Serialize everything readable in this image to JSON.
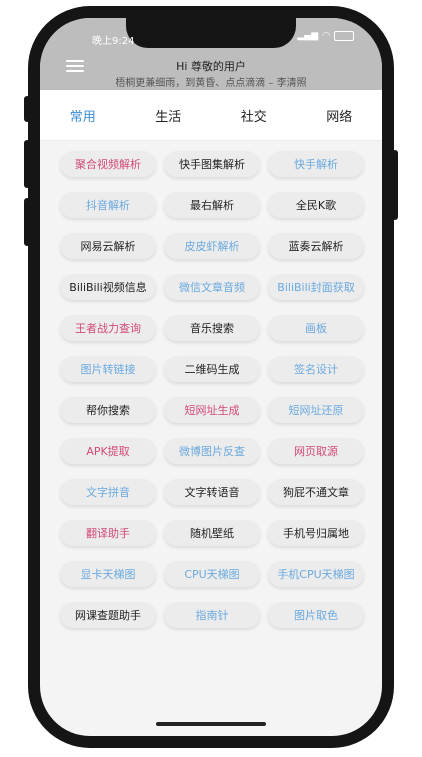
{
  "status": {
    "time": "晚上9:24"
  },
  "header": {
    "greeting": "Hi 尊敬的用户",
    "subtitle": "梧桐更兼细雨，到黄昏、点点滴滴 – 李清照"
  },
  "tabs": [
    {
      "label": "常用",
      "active": true
    },
    {
      "label": "生活",
      "active": false
    },
    {
      "label": "社交",
      "active": false
    },
    {
      "label": "网络",
      "active": false
    }
  ],
  "colors": {
    "pink": "#d24a77",
    "blue": "#6aa9df",
    "dark": "#222222",
    "active_tab": "#3b8ed6",
    "header_bg": "#bdbdbd"
  },
  "tools": [
    {
      "label": "聚合视频解析",
      "color": "pink"
    },
    {
      "label": "快手图集解析",
      "color": "dark"
    },
    {
      "label": "快手解析",
      "color": "blue"
    },
    {
      "label": "抖音解析",
      "color": "blue"
    },
    {
      "label": "最右解析",
      "color": "dark"
    },
    {
      "label": "全民K歌",
      "color": "dark"
    },
    {
      "label": "网易云解析",
      "color": "dark"
    },
    {
      "label": "皮皮虾解析",
      "color": "blue"
    },
    {
      "label": "蓝奏云解析",
      "color": "dark"
    },
    {
      "label": "BiliBili视频信息",
      "color": "dark"
    },
    {
      "label": "微信文章音频",
      "color": "blue"
    },
    {
      "label": "BiliBili封面获取",
      "color": "blue"
    },
    {
      "label": "王者战力查询",
      "color": "pink"
    },
    {
      "label": "音乐搜索",
      "color": "dark"
    },
    {
      "label": "画板",
      "color": "blue"
    },
    {
      "label": "图片转链接",
      "color": "blue"
    },
    {
      "label": "二维码生成",
      "color": "dark"
    },
    {
      "label": "签名设计",
      "color": "blue"
    },
    {
      "label": "帮你搜索",
      "color": "dark"
    },
    {
      "label": "短网址生成",
      "color": "pink"
    },
    {
      "label": "短网址还原",
      "color": "blue"
    },
    {
      "label": "APK提取",
      "color": "pink"
    },
    {
      "label": "微博图片反查",
      "color": "blue"
    },
    {
      "label": "网页取源",
      "color": "pink"
    },
    {
      "label": "文字拼音",
      "color": "blue"
    },
    {
      "label": "文字转语音",
      "color": "dark"
    },
    {
      "label": "狗屁不通文章",
      "color": "dark"
    },
    {
      "label": "翻译助手",
      "color": "pink"
    },
    {
      "label": "随机壁纸",
      "color": "dark"
    },
    {
      "label": "手机号归属地",
      "color": "dark"
    },
    {
      "label": "显卡天梯图",
      "color": "blue"
    },
    {
      "label": "CPU天梯图",
      "color": "blue"
    },
    {
      "label": "手机CPU天梯图",
      "color": "blue"
    },
    {
      "label": "网课查题助手",
      "color": "dark"
    },
    {
      "label": "指南针",
      "color": "blue"
    },
    {
      "label": "图片取色",
      "color": "blue"
    }
  ]
}
